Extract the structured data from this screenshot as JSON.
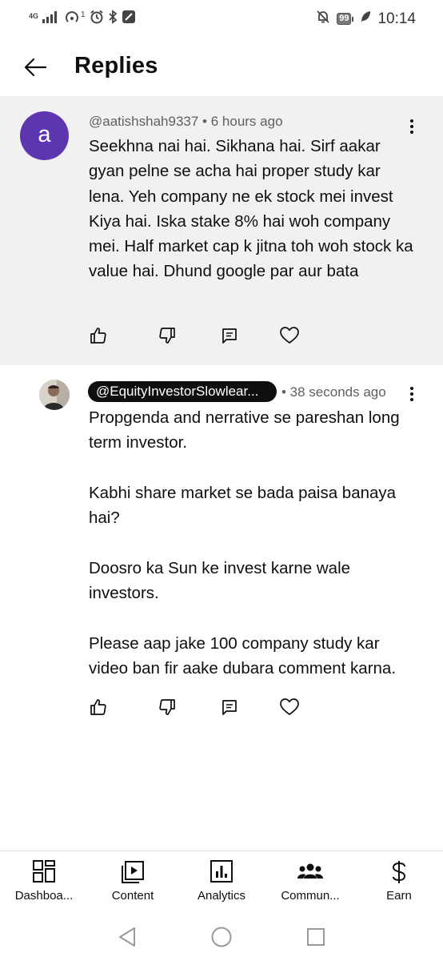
{
  "status_bar": {
    "network_label": "4G",
    "sim_count": "1",
    "time": "10:14",
    "battery_level": "99"
  },
  "header": {
    "title": "Replies"
  },
  "parent_comment": {
    "avatar_letter": "a",
    "avatar_color": "#5e35b1",
    "author": "@aatishshah9337",
    "separator": "•",
    "time": "6 hours ago",
    "text": "Seekhna nai hai. Sikhana hai. Sirf aakar gyan pelne se acha hai proper study kar lena. Yeh company ne ek stock mei invest Kiya hai. Iska stake 8% hai woh company mei. Half market cap k jitna toh woh stock ka value hai. Dhund google par aur bata"
  },
  "reply": {
    "author": "@EquityInvestorSlowlear...",
    "time": "• 38 seconds ago",
    "paragraphs": [
      "Propgenda and nerrative se pareshan long term investor.",
      "Kabhi share market se bada paisa banaya hai?",
      "Doosro ka Sun ke invest karne wale investors.",
      "Please aap jake 100 company study kar video ban fir aake dubara comment karna."
    ]
  },
  "bottom_nav": {
    "items": [
      {
        "label": "Dashboa...",
        "icon": "dashboard-icon"
      },
      {
        "label": "Content",
        "icon": "content-icon"
      },
      {
        "label": "Analytics",
        "icon": "analytics-icon"
      },
      {
        "label": "Commun...",
        "icon": "community-icon"
      },
      {
        "label": "Earn",
        "icon": "earn-icon"
      }
    ]
  }
}
